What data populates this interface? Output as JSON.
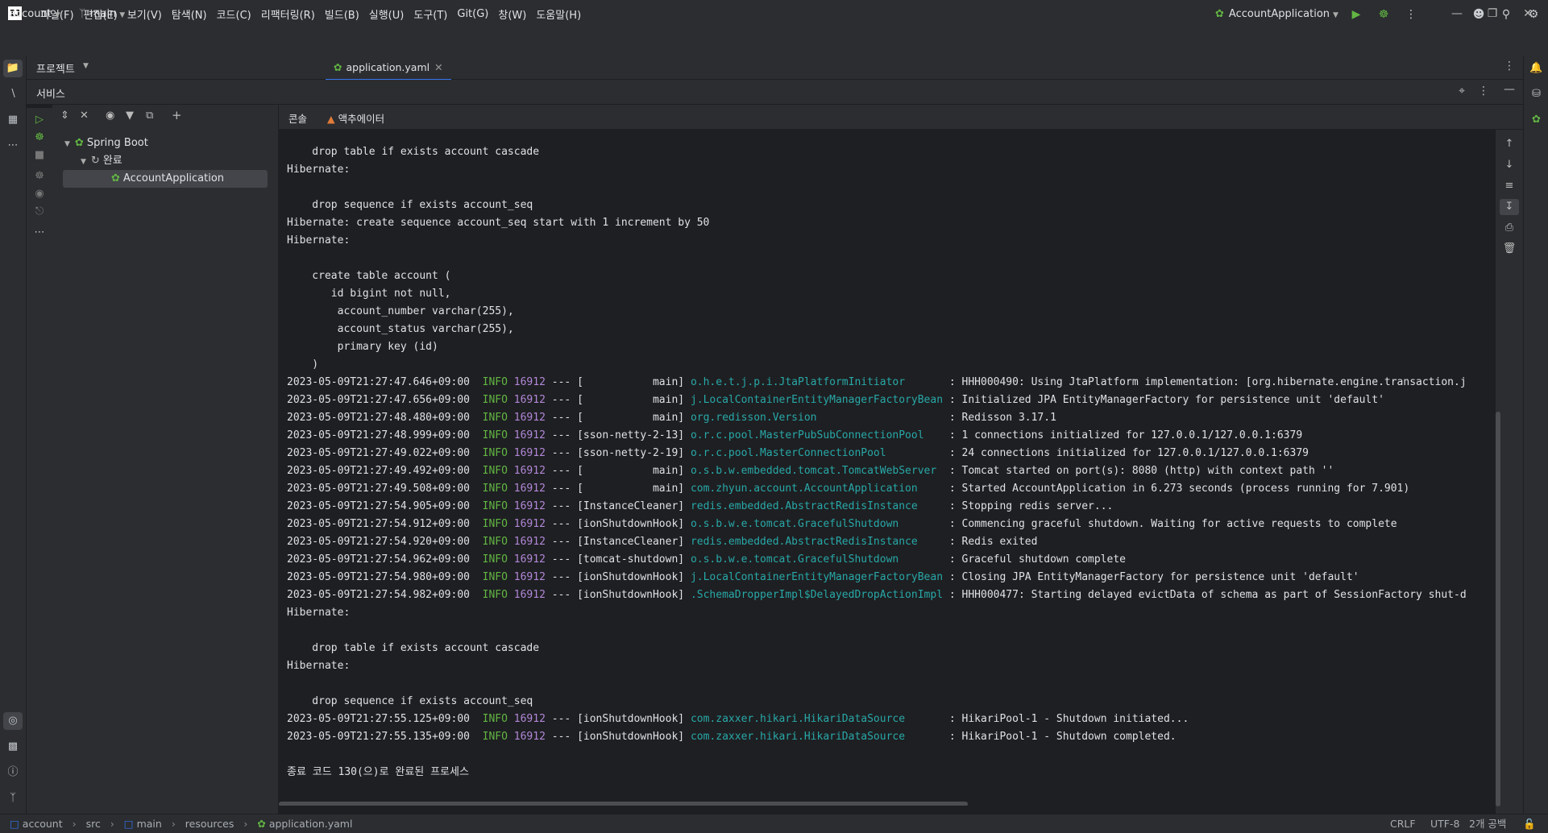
{
  "menu": [
    "파일(F)",
    "편집(E)",
    "보기(V)",
    "탐색(N)",
    "코드(C)",
    "리팩터링(R)",
    "빌드(B)",
    "실행(U)",
    "도구(T)",
    "Git(G)",
    "창(W)",
    "도움말(H)"
  ],
  "toolbar": {
    "project": "account",
    "branch": "main",
    "run_config": "AccountApplication"
  },
  "project_panel_title": "프로젝트",
  "editor_tab": "application.yaml",
  "services_title": "서비스",
  "tree": {
    "root": "Spring Boot",
    "group": "완료",
    "app": "AccountApplication"
  },
  "console_tabs": [
    "콘솔",
    "액추에이터"
  ],
  "console_lines": [
    {
      "text": "    drop table if exists account cascade"
    },
    {
      "text": "Hibernate:"
    },
    {
      "text": ""
    },
    {
      "text": "    drop sequence if exists account_seq"
    },
    {
      "text": "Hibernate: create sequence account_seq start with 1 increment by 50"
    },
    {
      "text": "Hibernate:"
    },
    {
      "text": ""
    },
    {
      "text": "    create table account ("
    },
    {
      "text": "       id bigint not null,"
    },
    {
      "text": "        account_number varchar(255),"
    },
    {
      "text": "        account_status varchar(255),"
    },
    {
      "text": "        primary key (id)"
    },
    {
      "text": "    )"
    },
    {
      "ts": "2023-05-09T21:27:47.646+09:00",
      "level": "INFO",
      "pid": "16912",
      "thread": "[           main]",
      "logger": "o.h.e.t.j.p.i.JtaPlatformInitiator      ",
      "msg": " : HHH000490: Using JtaPlatform implementation: [org.hibernate.engine.transaction.j"
    },
    {
      "ts": "2023-05-09T21:27:47.656+09:00",
      "level": "INFO",
      "pid": "16912",
      "thread": "[           main]",
      "logger": "j.LocalContainerEntityManagerFactoryBean",
      "msg": " : Initialized JPA EntityManagerFactory for persistence unit 'default'"
    },
    {
      "ts": "2023-05-09T21:27:48.480+09:00",
      "level": "INFO",
      "pid": "16912",
      "thread": "[           main]",
      "logger": "org.redisson.Version                    ",
      "msg": " : Redisson 3.17.1"
    },
    {
      "ts": "2023-05-09T21:27:48.999+09:00",
      "level": "INFO",
      "pid": "16912",
      "thread": "[sson-netty-2-13]",
      "logger": "o.r.c.pool.MasterPubSubConnectionPool   ",
      "msg": " : 1 connections initialized for 127.0.0.1/127.0.0.1:6379"
    },
    {
      "ts": "2023-05-09T21:27:49.022+09:00",
      "level": "INFO",
      "pid": "16912",
      "thread": "[sson-netty-2-19]",
      "logger": "o.r.c.pool.MasterConnectionPool         ",
      "msg": " : 24 connections initialized for 127.0.0.1/127.0.0.1:6379"
    },
    {
      "ts": "2023-05-09T21:27:49.492+09:00",
      "level": "INFO",
      "pid": "16912",
      "thread": "[           main]",
      "logger": "o.s.b.w.embedded.tomcat.TomcatWebServer ",
      "msg": " : Tomcat started on port(s): 8080 (http) with context path ''"
    },
    {
      "ts": "2023-05-09T21:27:49.508+09:00",
      "level": "INFO",
      "pid": "16912",
      "thread": "[           main]",
      "logger": "com.zhyun.account.AccountApplication    ",
      "msg": " : Started AccountApplication in 6.273 seconds (process running for 7.901)"
    },
    {
      "ts": "2023-05-09T21:27:54.905+09:00",
      "level": "INFO",
      "pid": "16912",
      "thread": "[InstanceCleaner]",
      "logger": "redis.embedded.AbstractRedisInstance    ",
      "msg": " : Stopping redis server..."
    },
    {
      "ts": "2023-05-09T21:27:54.912+09:00",
      "level": "INFO",
      "pid": "16912",
      "thread": "[ionShutdownHook]",
      "logger": "o.s.b.w.e.tomcat.GracefulShutdown       ",
      "msg": " : Commencing graceful shutdown. Waiting for active requests to complete"
    },
    {
      "ts": "2023-05-09T21:27:54.920+09:00",
      "level": "INFO",
      "pid": "16912",
      "thread": "[InstanceCleaner]",
      "logger": "redis.embedded.AbstractRedisInstance    ",
      "msg": " : Redis exited"
    },
    {
      "ts": "2023-05-09T21:27:54.962+09:00",
      "level": "INFO",
      "pid": "16912",
      "thread": "[tomcat-shutdown]",
      "logger": "o.s.b.w.e.tomcat.GracefulShutdown       ",
      "msg": " : Graceful shutdown complete"
    },
    {
      "ts": "2023-05-09T21:27:54.980+09:00",
      "level": "INFO",
      "pid": "16912",
      "thread": "[ionShutdownHook]",
      "logger": "j.LocalContainerEntityManagerFactoryBean",
      "msg": " : Closing JPA EntityManagerFactory for persistence unit 'default'"
    },
    {
      "ts": "2023-05-09T21:27:54.982+09:00",
      "level": "INFO",
      "pid": "16912",
      "thread": "[ionShutdownHook]",
      "logger": ".SchemaDropperImpl$DelayedDropActionImpl",
      "msg": " : HHH000477: Starting delayed evictData of schema as part of SessionFactory shut-d"
    },
    {
      "text": "Hibernate:"
    },
    {
      "text": ""
    },
    {
      "text": "    drop table if exists account cascade"
    },
    {
      "text": "Hibernate:"
    },
    {
      "text": ""
    },
    {
      "text": "    drop sequence if exists account_seq"
    },
    {
      "ts": "2023-05-09T21:27:55.125+09:00",
      "level": "INFO",
      "pid": "16912",
      "thread": "[ionShutdownHook]",
      "logger": "com.zaxxer.hikari.HikariDataSource      ",
      "msg": " : HikariPool-1 - Shutdown initiated..."
    },
    {
      "ts": "2023-05-09T21:27:55.135+09:00",
      "level": "INFO",
      "pid": "16912",
      "thread": "[ionShutdownHook]",
      "logger": "com.zaxxer.hikari.HikariDataSource      ",
      "msg": " : HikariPool-1 - Shutdown completed."
    },
    {
      "text": ""
    },
    {
      "text": "종료 코드 130(으)로 완료된 프로세스"
    }
  ],
  "breadcrumb": [
    "account",
    "src",
    "main",
    "resources",
    "application.yaml"
  ],
  "status": {
    "line_sep": "CRLF",
    "encoding": "UTF-8",
    "indent": "2개 공백"
  },
  "colors": {
    "accent": "#3574f0",
    "info": "#62b543",
    "pid": "#b388d9",
    "logger": "#28a8a8"
  }
}
